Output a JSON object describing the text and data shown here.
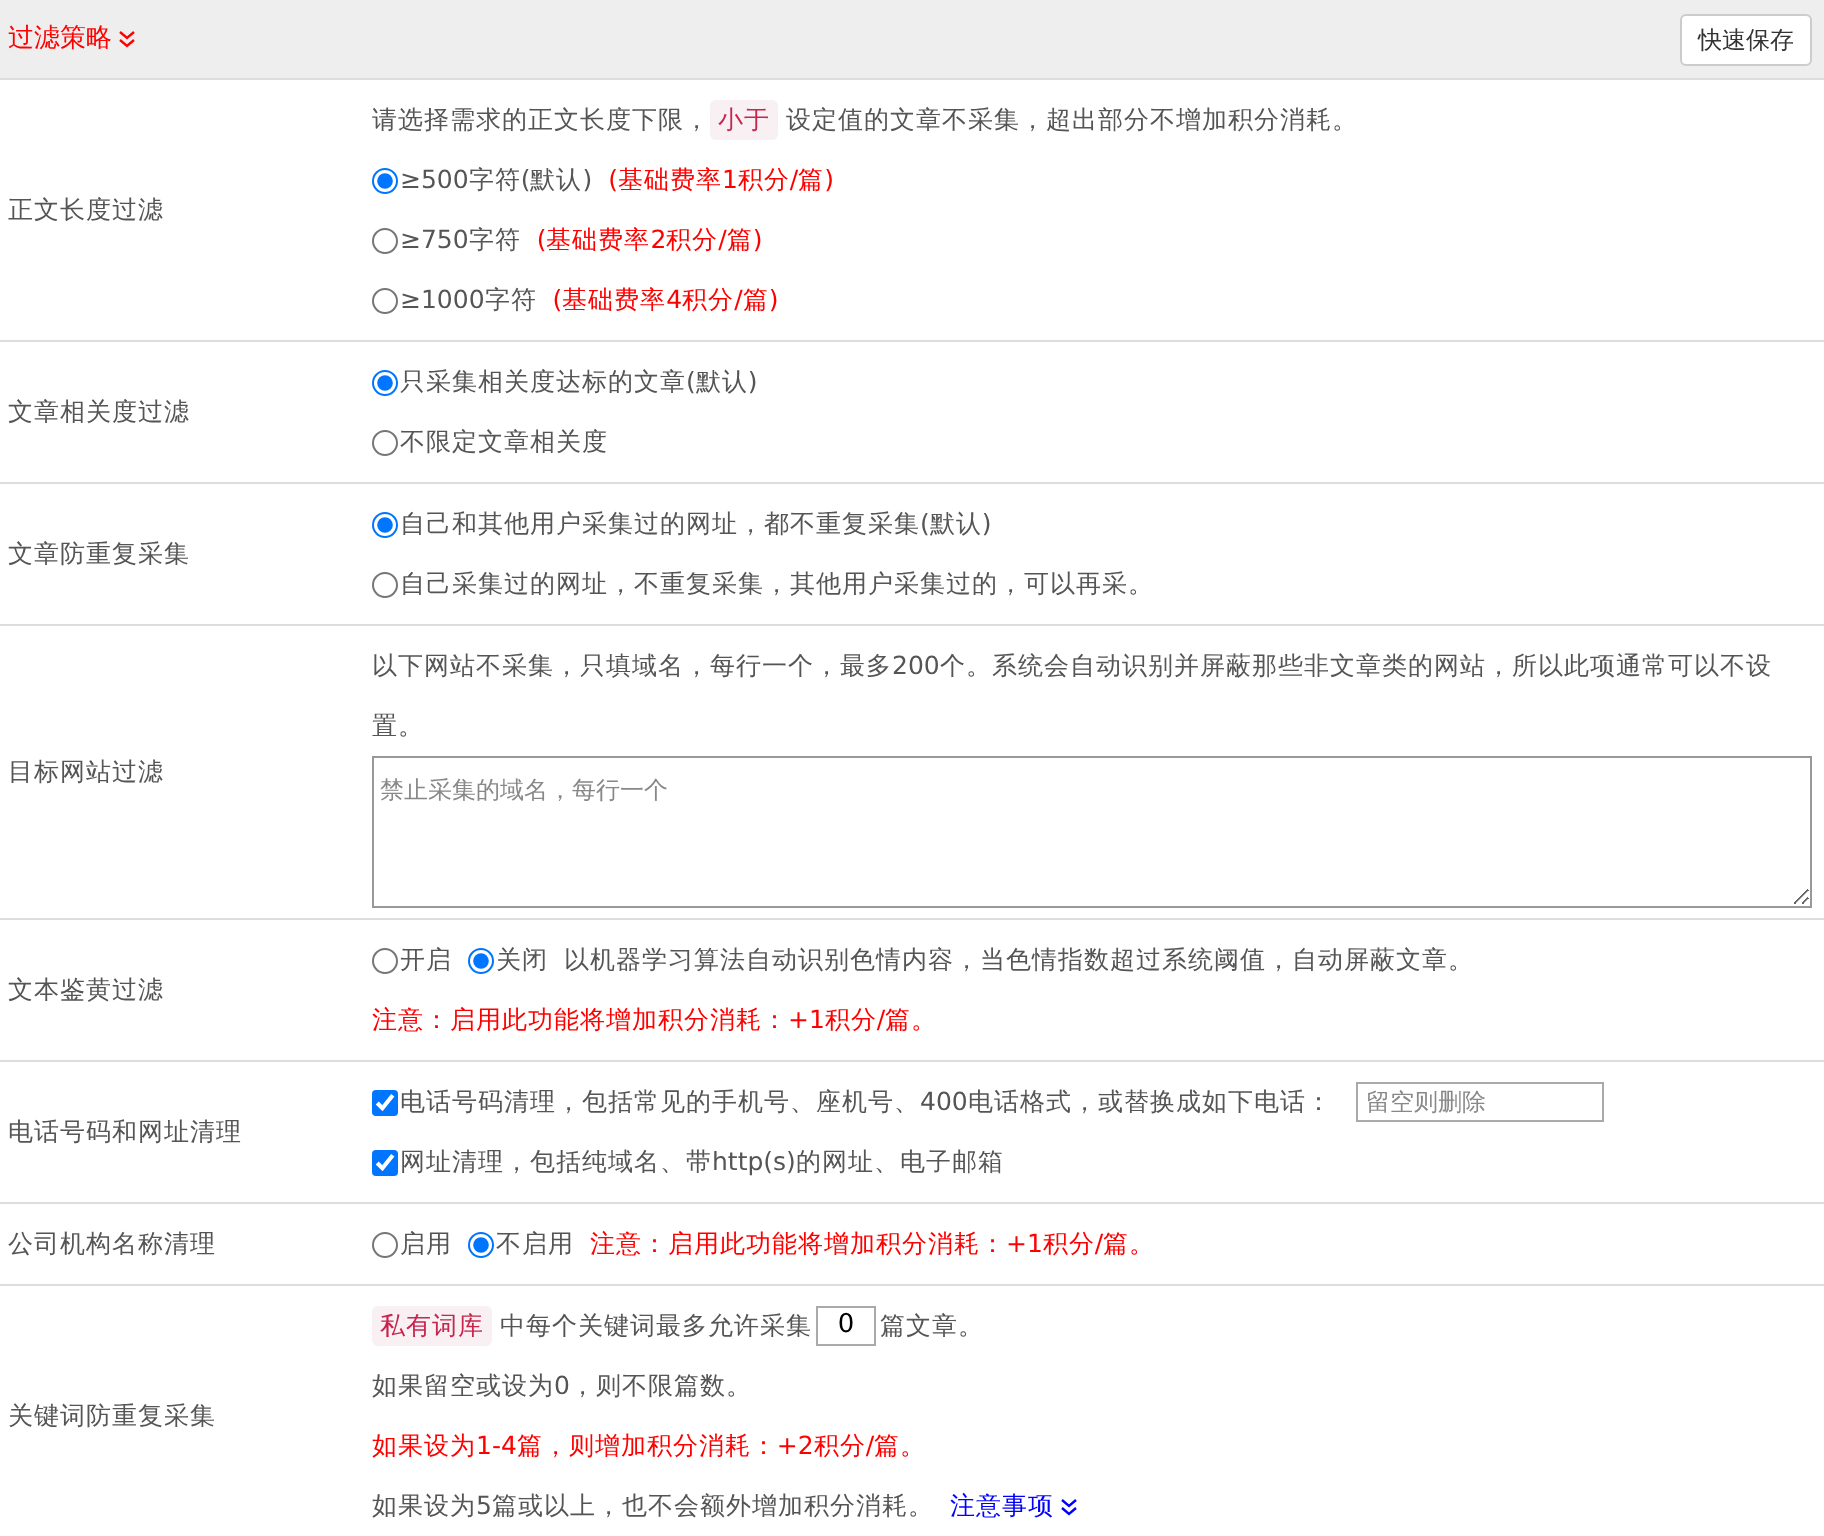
{
  "header": {
    "title": "过滤策略",
    "button": "快速保存"
  },
  "rows": [
    {
      "label": "正文长度过滤",
      "lines": [
        [
          {
            "kind": "text",
            "text": "请选择需求的正文长度下限，"
          },
          {
            "kind": "tag",
            "text": "小于"
          },
          {
            "kind": "text",
            "text": "设定值的文章不采集，超出部分不增加积分消耗。"
          }
        ],
        [
          {
            "kind": "radio",
            "text": "≥500字符(默认)",
            "selected": true
          },
          {
            "kind": "note",
            "text": "(基础费率1积分/篇)"
          }
        ],
        [
          {
            "kind": "radio",
            "text": "≥750字符",
            "selected": false
          },
          {
            "kind": "note",
            "text": "(基础费率2积分/篇)"
          }
        ],
        [
          {
            "kind": "radio",
            "text": "≥1000字符",
            "selected": false
          },
          {
            "kind": "note",
            "text": "(基础费率4积分/篇)"
          }
        ]
      ]
    },
    {
      "label": "文章相关度过滤",
      "lines": [
        [
          {
            "kind": "radio",
            "text": "只采集相关度达标的文章(默认)",
            "selected": true
          }
        ],
        [
          {
            "kind": "radio",
            "text": "不限定文章相关度",
            "selected": false
          }
        ]
      ]
    },
    {
      "label": "文章防重复采集",
      "lines": [
        [
          {
            "kind": "radio",
            "text": "自己和其他用户采集过的网址，都不重复采集(默认)",
            "selected": true
          }
        ],
        [
          {
            "kind": "radio",
            "text": "自己采集过的网址，不重复采集，其他用户采集过的，可以再采。",
            "selected": false
          }
        ]
      ]
    },
    {
      "label": "目标网站过滤",
      "lines": [
        [
          {
            "kind": "text",
            "text": "以下网站不采集，只填域名，每行一个，最多200个。系统会自动识别并屏蔽那些非文章类的网站，所以此项通常可以不设置。"
          }
        ],
        [
          {
            "kind": "textarea",
            "placeholder": "禁止采集的域名，每行一个"
          }
        ]
      ]
    },
    {
      "label": "文本鉴黄过滤",
      "lines": [
        [
          {
            "kind": "radio",
            "text": "开启",
            "selected": false
          },
          {
            "kind": "radio",
            "text": "关闭",
            "selected": true
          },
          {
            "kind": "text",
            "text": "以机器学习算法自动识别色情内容，当色情指数超过系统阈值，自动屏蔽文章。"
          }
        ],
        [
          {
            "kind": "note",
            "text": "注意：启用此功能将增加积分消耗：+1积分/篇。"
          }
        ]
      ]
    },
    {
      "label": "电话号码和网址清理",
      "lines": [
        [
          {
            "kind": "checkbox",
            "text": "电话号码清理，包括常见的手机号、座机号、400电话格式，或替换成如下电话：",
            "checked": true
          },
          {
            "kind": "input",
            "placeholder": "留空则删除"
          }
        ],
        [
          {
            "kind": "checkbox",
            "text": "网址清理，包括纯域名、带http(s)的网址、电子邮箱",
            "checked": true
          }
        ]
      ]
    },
    {
      "label": "公司机构名称清理",
      "lines": [
        [
          {
            "kind": "radio",
            "text": "启用",
            "selected": false
          },
          {
            "kind": "radio",
            "text": "不启用",
            "selected": true
          },
          {
            "kind": "note",
            "text": "注意：启用此功能将增加积分消耗：+1积分/篇。"
          }
        ]
      ]
    },
    {
      "label": "关键词防重复采集",
      "lines": [
        [
          {
            "kind": "tag",
            "text": "私有词库"
          },
          {
            "kind": "text",
            "text": "中每个关键词最多允许采集"
          },
          {
            "kind": "number",
            "value": "0"
          },
          {
            "kind": "text",
            "text": "篇文章。"
          }
        ],
        [
          {
            "kind": "text",
            "text": "如果留空或设为0，则不限篇数。"
          }
        ],
        [
          {
            "kind": "note",
            "text": "如果设为1-4篇，则增加积分消耗：+2积分/篇。"
          }
        ],
        [
          {
            "kind": "text",
            "text": "如果设为5篇或以上，也不会额外增加积分消耗。"
          },
          {
            "kind": "link",
            "text": "注意事项"
          }
        ]
      ]
    }
  ]
}
